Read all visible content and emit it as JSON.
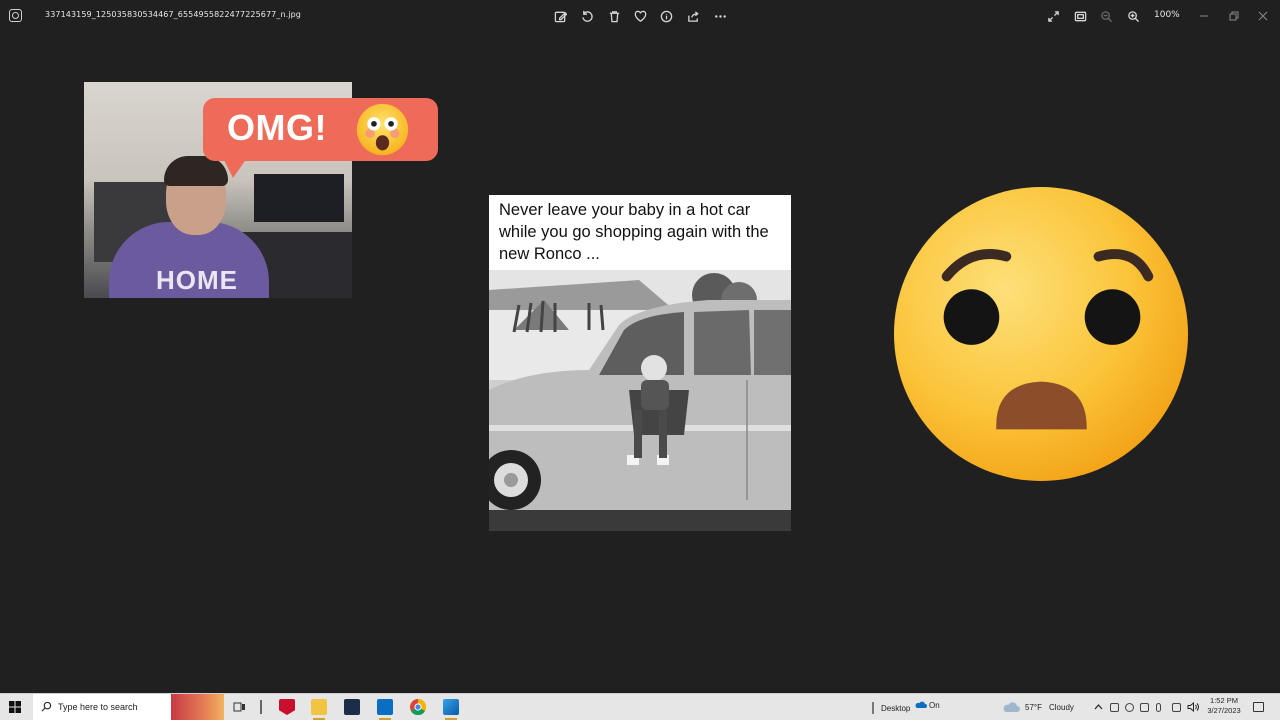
{
  "titlebar": {
    "filename": "337143159_125035830534467_6554955822477225677_n.jpg",
    "zoom": "100%",
    "toolbar_icons": [
      "edit-image-icon",
      "rotate-icon",
      "delete-icon",
      "favorite-icon",
      "info-icon",
      "share-icon",
      "more-icon"
    ],
    "right_icons": [
      "fullscreen-icon",
      "fit-to-window-icon",
      "zoom-out-icon",
      "zoom-in-icon"
    ]
  },
  "content": {
    "bubble_text": "OMG!",
    "shirt_text": "HOME",
    "meme_caption": "Never leave your baby in a hot car while you go shopping again with the new Ronco ..."
  },
  "taskbar": {
    "search_placeholder": "Type here to search",
    "desktop_label": "Desktop",
    "onedrive_label": "On",
    "weather_temp": "57°F",
    "weather_condition": "Cloudy",
    "time": "1:52 PM",
    "date": "3/27/2023"
  },
  "colors": {
    "background": "#202020",
    "bubble": "#ef6b59",
    "emoji_yellow": "#fbc02d",
    "taskbar": "#e6e6e6"
  }
}
